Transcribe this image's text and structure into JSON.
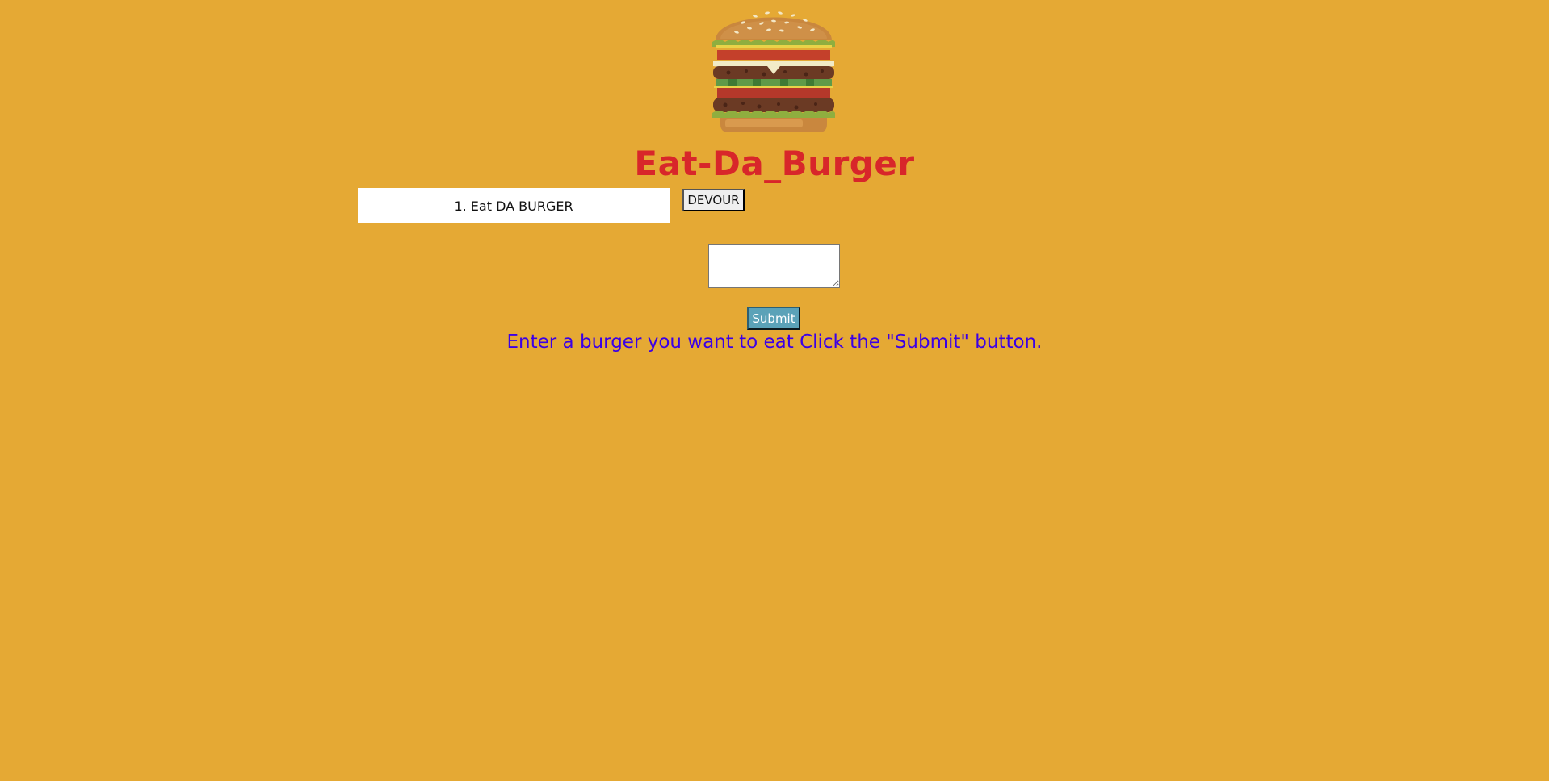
{
  "header": {
    "logo_icon": "burger-icon",
    "title": "Eat-Da_Burger"
  },
  "burgers": {
    "items": [
      {
        "label": "1. Eat DA BURGER",
        "action_label": "DEVOUR"
      }
    ]
  },
  "form": {
    "input_value": "",
    "submit_label": "Submit"
  },
  "instructions": "Enter a burger you want to eat Click the \"Submit\" button.",
  "colors": {
    "background": "#e5a934",
    "title": "#d8262a",
    "instructions": "#3b00e6",
    "submit_button": "#5ba2b8"
  }
}
